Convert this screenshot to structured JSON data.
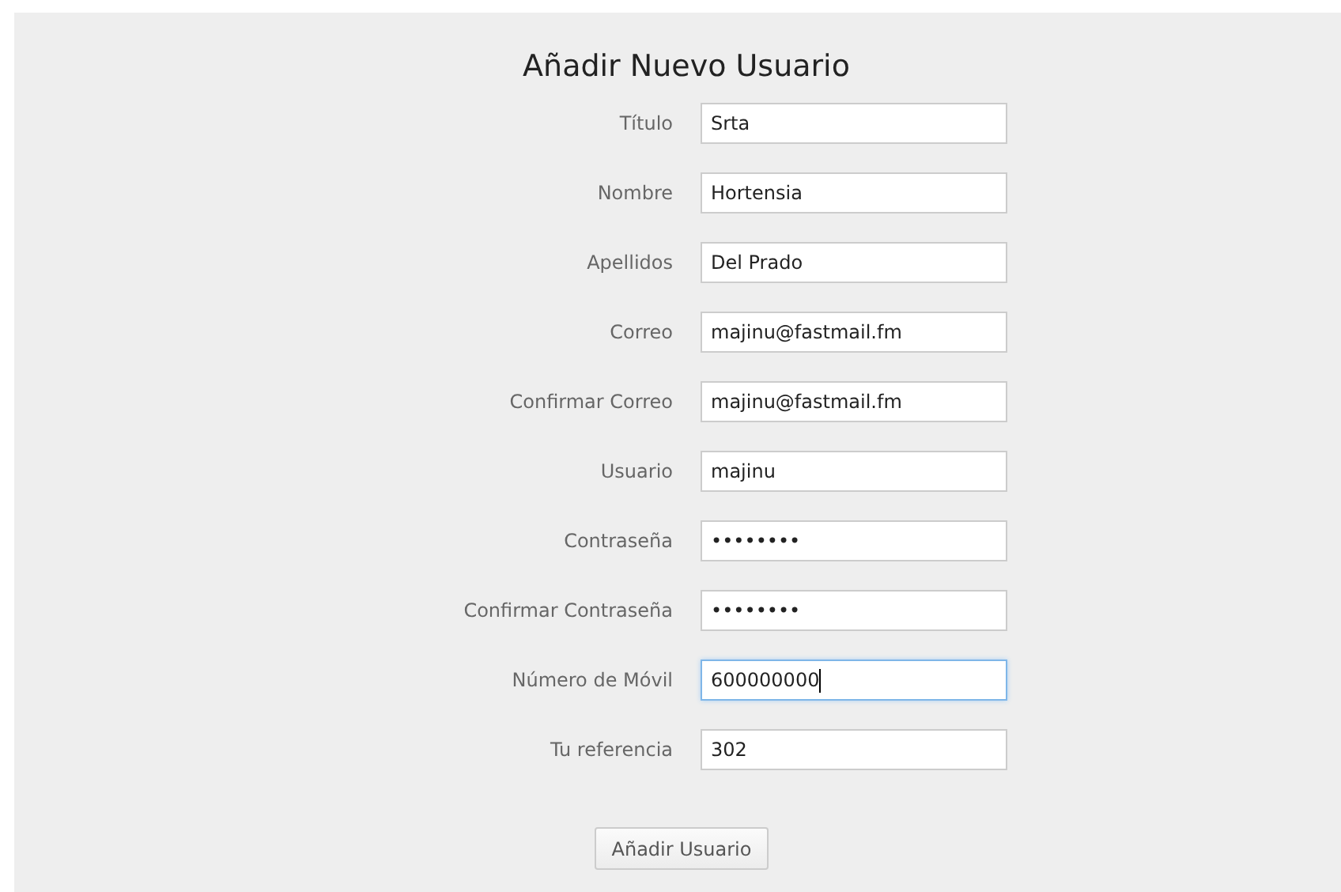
{
  "title": "Añadir Nuevo Usuario",
  "fields": [
    {
      "label": "Título",
      "value": "Srta",
      "focused": false
    },
    {
      "label": "Nombre",
      "value": "Hortensia",
      "focused": false
    },
    {
      "label": "Apellidos",
      "value": "Del Prado",
      "focused": false
    },
    {
      "label": "Correo",
      "value": "majinu@fastmail.fm",
      "focused": false
    },
    {
      "label": "Confirmar Correo",
      "value": "majinu@fastmail.fm",
      "focused": false
    },
    {
      "label": "Usuario",
      "value": "majinu",
      "focused": false
    },
    {
      "label": "Contraseña",
      "value": "••••••••",
      "focused": false
    },
    {
      "label": "Confirmar Contraseña",
      "value": "••••••••",
      "focused": false
    },
    {
      "label": "Número de Móvil",
      "value": "600000000",
      "focused": true
    },
    {
      "label": "Tu referencia",
      "value": "302",
      "focused": false
    }
  ],
  "submit": "Añadir Usuario"
}
